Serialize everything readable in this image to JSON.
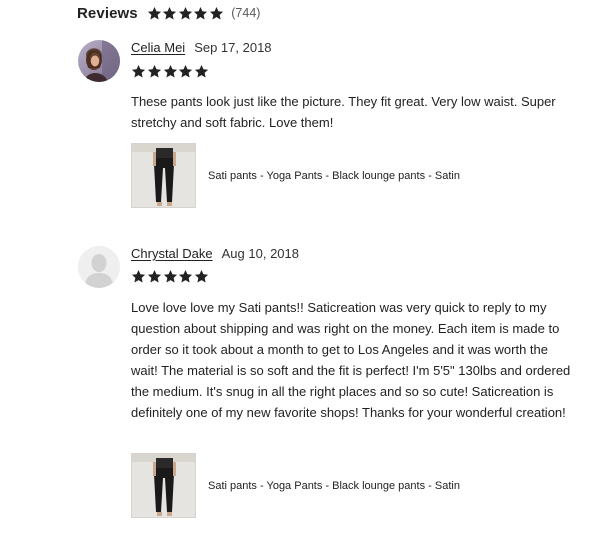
{
  "header": {
    "title": "Reviews",
    "rating": 5,
    "count": "(744)"
  },
  "colors": {
    "star": "#222222",
    "text": "#222222",
    "muted": "#595959"
  },
  "reviews": [
    {
      "name": "Celia Mei",
      "date": "Sep 17, 2018",
      "rating": 5,
      "avatar": "user-photo",
      "text": "These pants look just like the picture. They fit great. Very low waist. Super stretchy and soft fabric. Love them!",
      "product": {
        "title": "Sati pants - Yoga Pants - Black lounge pants - Satin",
        "image": "black-pants-thumbnail"
      }
    },
    {
      "name": "Chrystal Dake",
      "date": "Aug 10, 2018",
      "rating": 5,
      "avatar": "default-person-icon",
      "text": "Love love love my Sati pants!! Saticreation was very quick to reply to my question about shipping and was right on the money. Each item is made to order so it took about a month to get to Los Angeles and it was worth the wait! The material is so soft and the fit is perfect! I'm 5'5\" 130lbs and ordered the medium. It's snug in all the right places and so so cute! Saticreation is definitely one of my new favorite shops! Thanks for your wonderful creation!",
      "product": {
        "title": "Sati pants - Yoga Pants - Black lounge pants - Satin",
        "image": "black-pants-thumbnail"
      }
    }
  ]
}
